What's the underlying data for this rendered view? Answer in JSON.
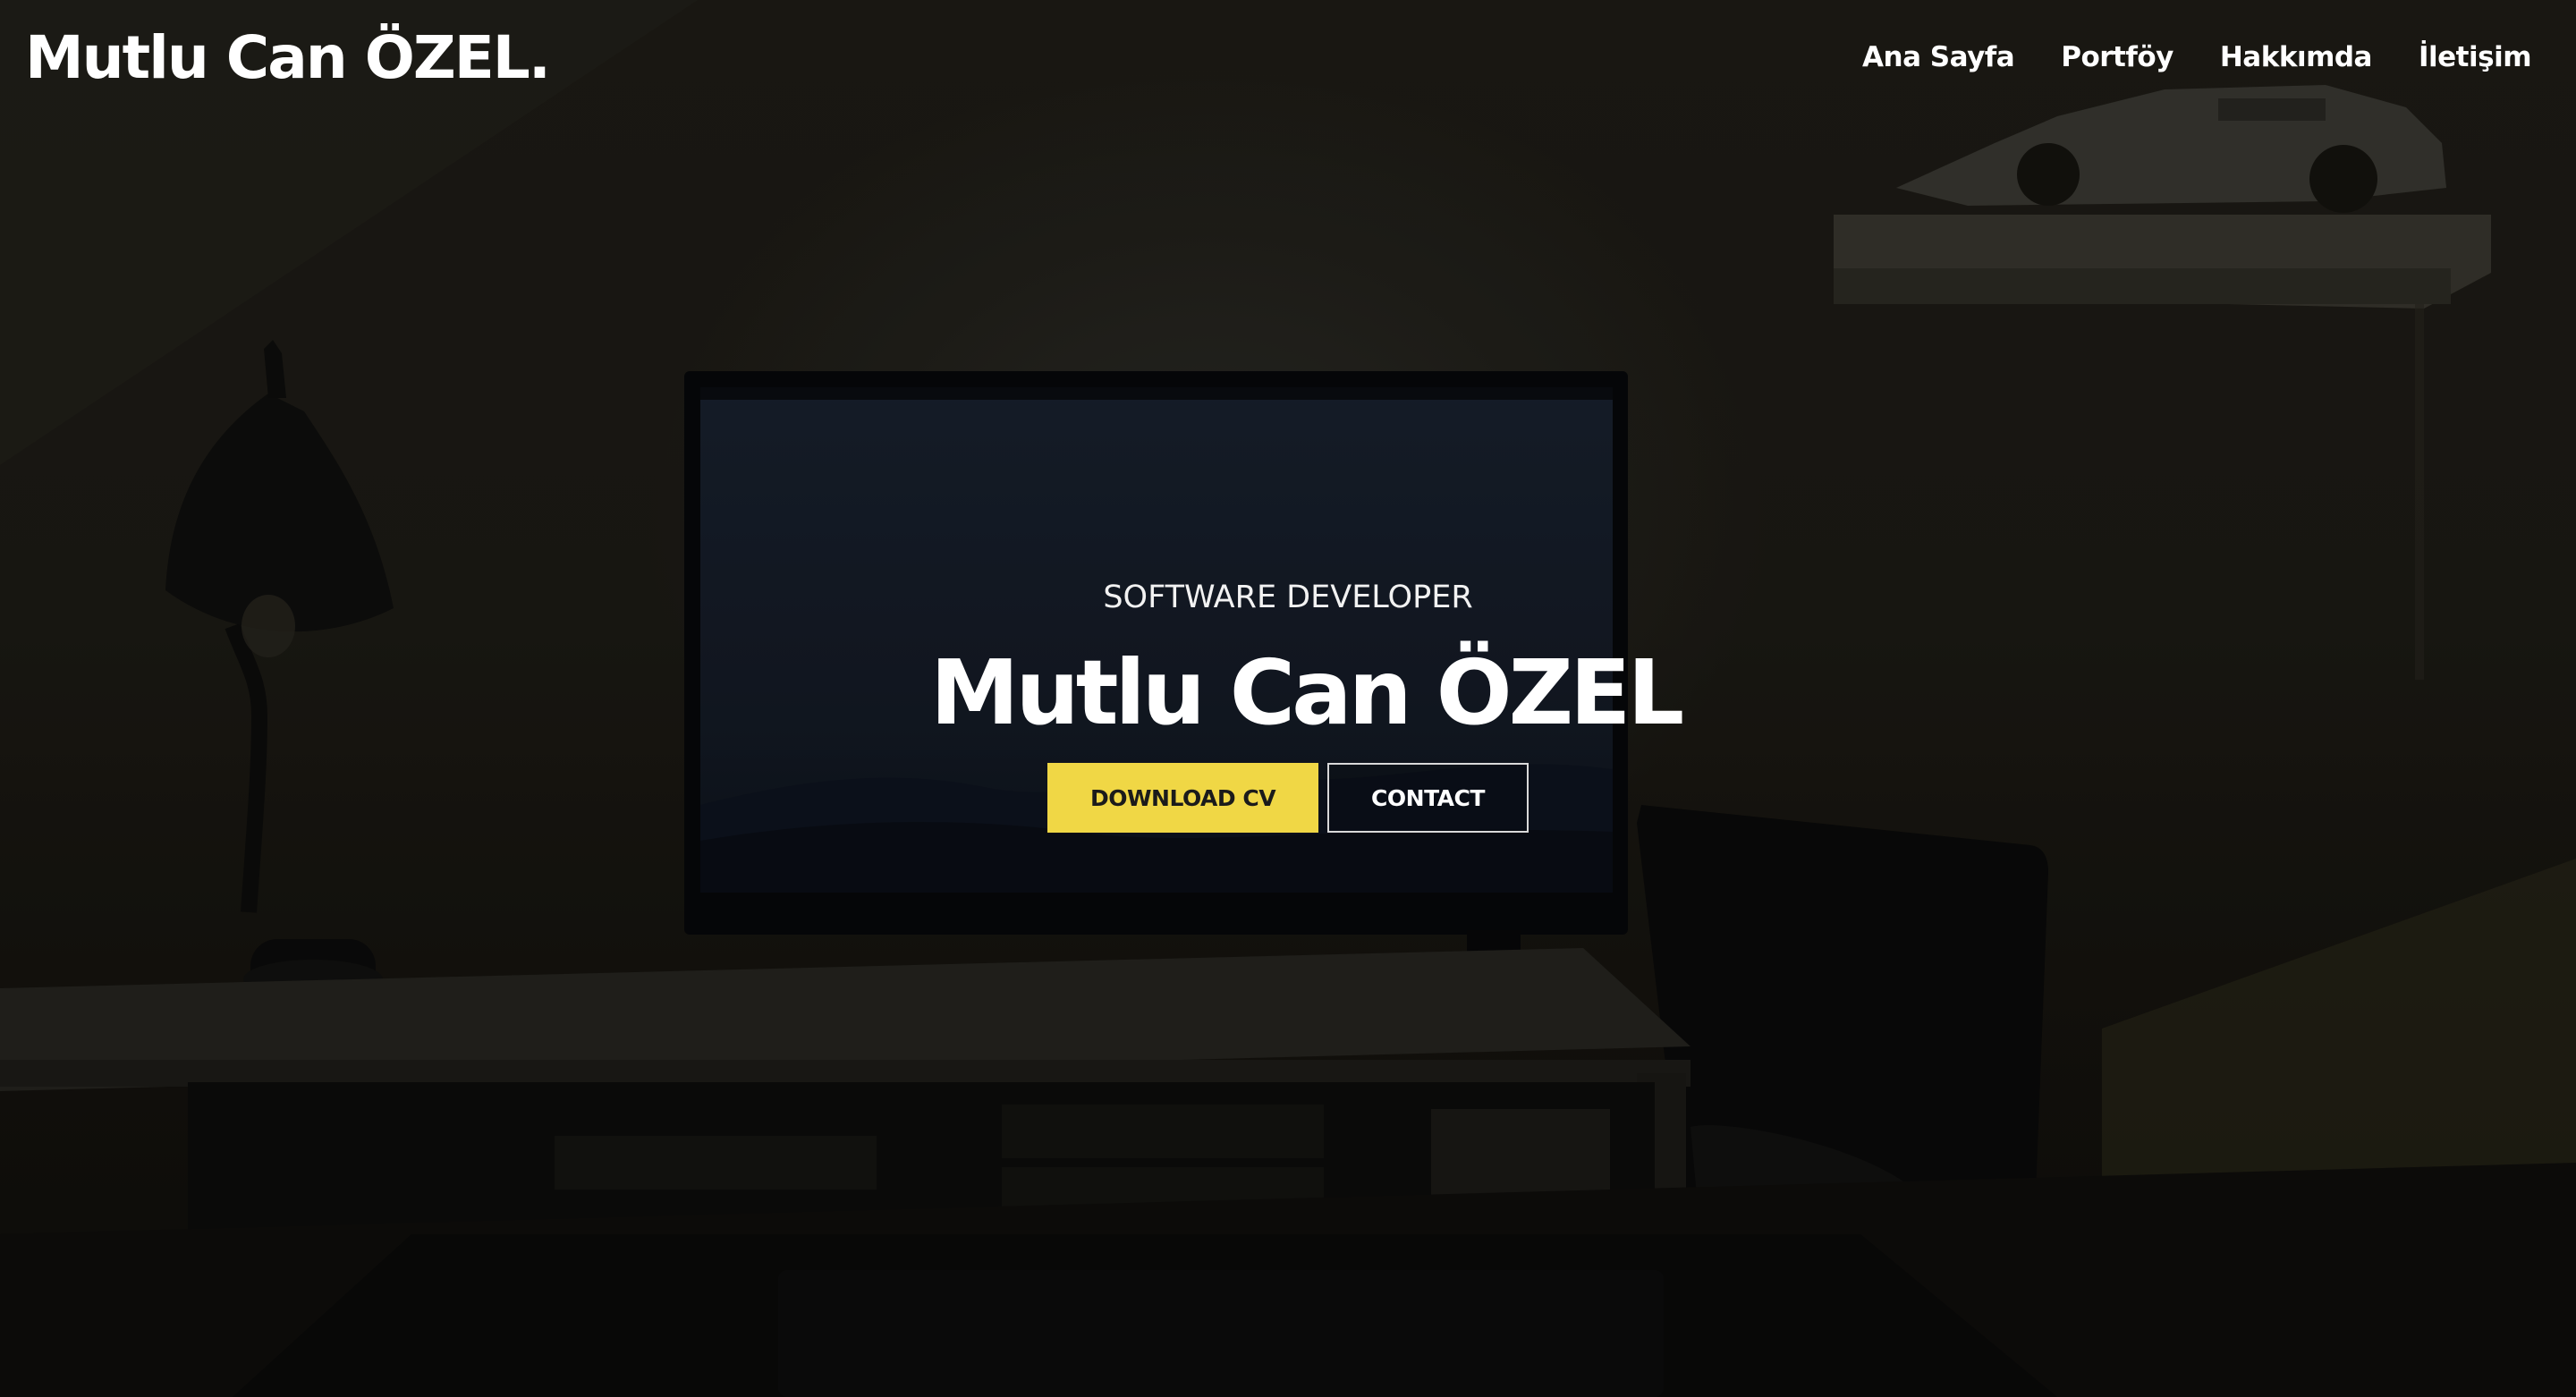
{
  "navbar": {
    "brand": "Mutlu Can ÖZEL.",
    "links": [
      "Ana Sayfa",
      "Portföy",
      "Hakkımda",
      "İletişim"
    ]
  },
  "hero": {
    "subtitle": "SOFTWARE DEVELOPER",
    "title": "Mutlu Can ÖZEL",
    "primary_button": "DOWNLOAD CV",
    "secondary_button": "CONTACT"
  },
  "colors": {
    "accent": "#f0d745",
    "text": "#ffffff",
    "overlay": "#1d1b15"
  }
}
